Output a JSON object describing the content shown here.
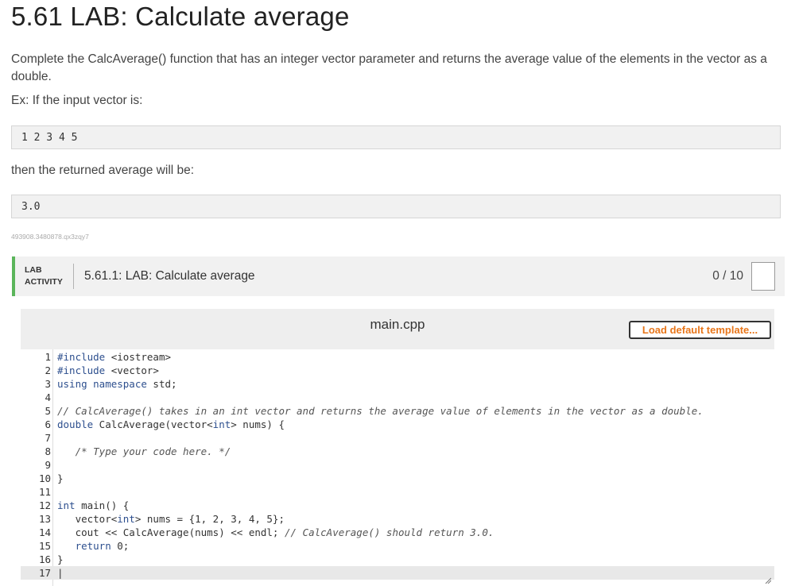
{
  "page": {
    "title": "5.61 LAB: Calculate average",
    "description": "Complete the CalcAverage() function that has an integer vector parameter and returns the average value of the elements in the vector as a double.",
    "example_intro": "Ex: If the input vector is:",
    "example_input": "1 2 3 4 5",
    "then_text": "then the returned average will be:",
    "example_output": "3.0",
    "tiny_id": "493908.3480878.qx3zqy7"
  },
  "lab": {
    "tag_line1": "LAB",
    "tag_line2": "ACTIVITY",
    "title": "5.61.1: LAB: Calculate average",
    "score": "0 / 10"
  },
  "editor": {
    "file_name": "main.cpp",
    "load_button": "Load default template...",
    "line_numbers": [
      "1",
      "2",
      "3",
      "4",
      "5",
      "6",
      "7",
      "8",
      "9",
      "10",
      "11",
      "12",
      "13",
      "14",
      "15",
      "16",
      "17"
    ]
  },
  "colors": {
    "accent_green": "#5bb55b",
    "button_orange": "#e8761a"
  }
}
